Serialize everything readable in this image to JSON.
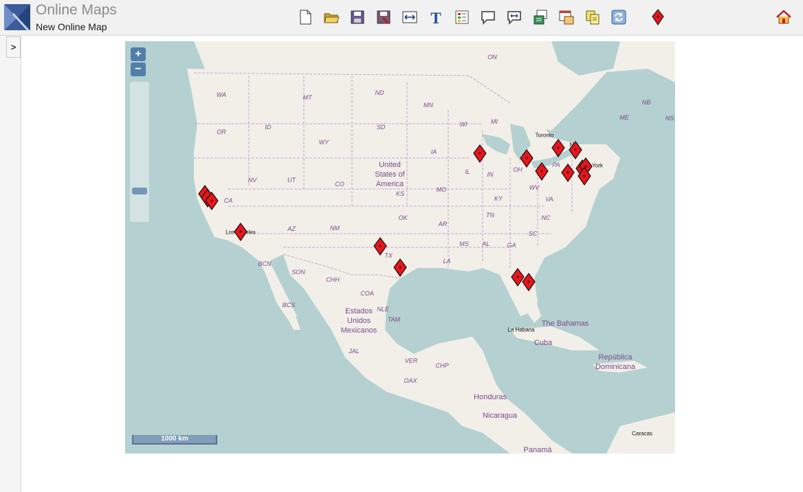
{
  "app": {
    "title": "Online Maps",
    "map_name": "New Online Map"
  },
  "toolbar": [
    {
      "name": "new-map-button",
      "icon": "new-document-icon"
    },
    {
      "name": "open-map-button",
      "icon": "folder-open-icon"
    },
    {
      "name": "save-map-button",
      "icon": "save-icon"
    },
    {
      "name": "save-as-button",
      "icon": "save-as-icon"
    },
    {
      "name": "resize-map-button",
      "icon": "resize-arrows-icon"
    },
    {
      "name": "add-text-button",
      "icon": "text-t-icon"
    },
    {
      "name": "legend-button",
      "icon": "legend-grid-icon"
    },
    {
      "name": "callout-button",
      "icon": "speech-bubble-icon"
    },
    {
      "name": "callout-arrow-button",
      "icon": "speech-arrows-icon"
    },
    {
      "name": "import-data-button",
      "icon": "import-data-icon"
    },
    {
      "name": "layer-properties-button",
      "icon": "layer-window-icon"
    },
    {
      "name": "copy-layer-button",
      "icon": "copy-layer-icon"
    },
    {
      "name": "refresh-button",
      "icon": "refresh-icon"
    },
    {
      "name": "add-marker-button",
      "icon": "red-marker-icon"
    }
  ],
  "home": {
    "icon": "home-icon"
  },
  "sidebar": {
    "toggle_label": ">"
  },
  "map": {
    "zoom_in": "+",
    "zoom_out": "−",
    "scale_label": "1000 km",
    "zoom_level_fraction": 0.77,
    "state_labels": [
      "WA",
      "MT",
      "ND",
      "MN",
      "OR",
      "ID",
      "SD",
      "WI",
      "MI",
      "WY",
      "IA",
      "NV",
      "UT",
      "CO",
      "IL",
      "IN",
      "OH",
      "PA",
      "CA",
      "KS",
      "MO",
      "KY",
      "WV",
      "VA",
      "AZ",
      "NM",
      "OK",
      "AR",
      "TN",
      "NC",
      "TX",
      "MS",
      "AL",
      "GA",
      "SC",
      "LA",
      "ON",
      "NB",
      "ME",
      "NS",
      "BCN",
      "SON",
      "CHH",
      "COA",
      "NLE",
      "TAM",
      "BCS",
      "JAL",
      "VER",
      "OAX",
      "CHP"
    ],
    "country_labels": [
      "United",
      "States of",
      "America",
      "Estados",
      "Unidos",
      "Mexicanos",
      "The Bahamas",
      "Cuba",
      "República",
      "Dominicana",
      "Honduras",
      "Nicaragua",
      "Panamá"
    ],
    "city_labels": [
      "Toronto",
      "Los Angeles",
      "La Habana",
      "Caracas",
      "NY",
      "New York"
    ]
  },
  "colors": {
    "land": "#f2efe9",
    "water": "#b5d0d0",
    "marker": "#e8151b",
    "label": "#7a4a8b"
  }
}
